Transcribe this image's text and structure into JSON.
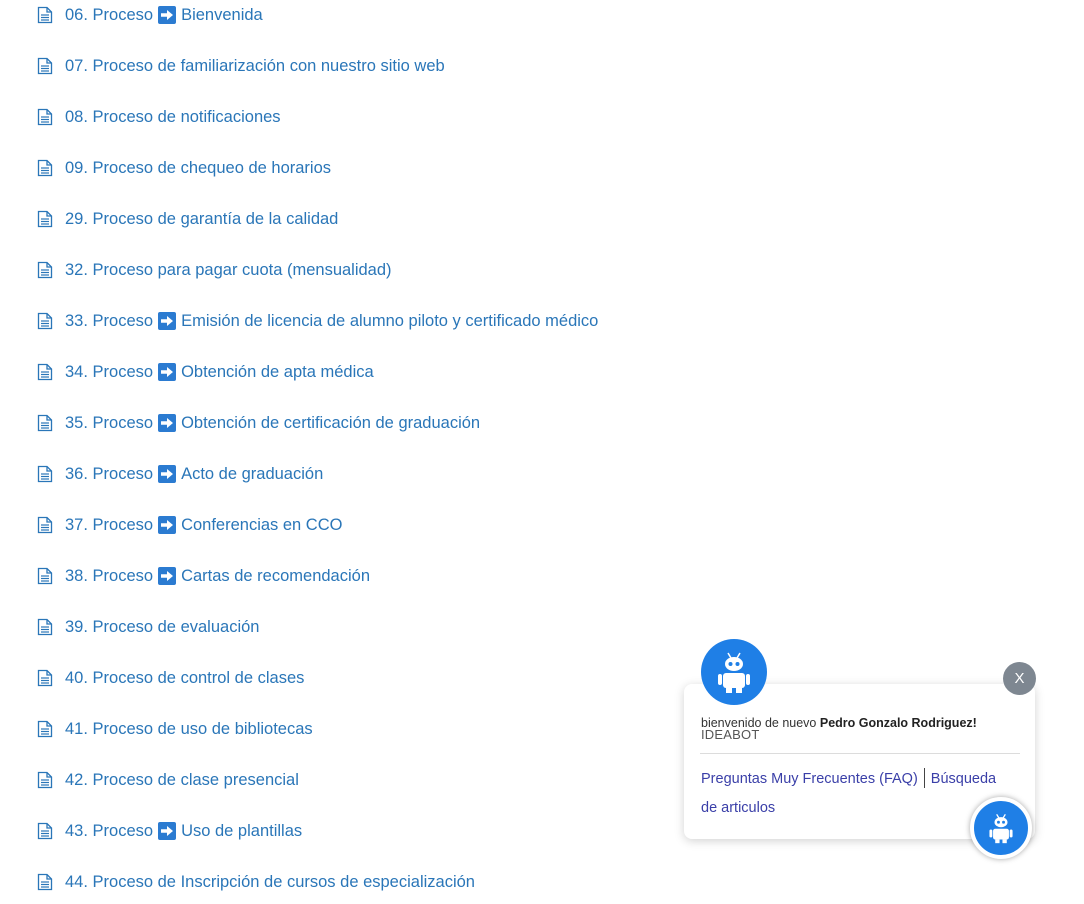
{
  "icons": {
    "document": "document-icon",
    "arrow": "right-arrow-box-icon",
    "bot": "robot-icon"
  },
  "colors": {
    "link": "#2a76b8",
    "arrow_box": "#2b7bd1",
    "bot_blue": "#1f7fe6",
    "close_gray": "#7e8791",
    "chat_link": "#3a3fa8"
  },
  "articles": [
    {
      "prefix": "06. Proceso",
      "arrow": true,
      "title": "Bienvenida"
    },
    {
      "prefix": "07. Proceso de familiarización con nuestro sitio web",
      "arrow": false,
      "title": ""
    },
    {
      "prefix": "08. Proceso de notificaciones",
      "arrow": false,
      "title": ""
    },
    {
      "prefix": "09. Proceso de chequeo de horarios",
      "arrow": false,
      "title": ""
    },
    {
      "prefix": "29. Proceso de garantía de la calidad",
      "arrow": false,
      "title": ""
    },
    {
      "prefix": "32. Proceso para pagar cuota (mensualidad)",
      "arrow": false,
      "title": ""
    },
    {
      "prefix": "33. Proceso",
      "arrow": true,
      "title": "Emisión de licencia de alumno piloto y certificado médico"
    },
    {
      "prefix": "34. Proceso",
      "arrow": true,
      "title": "Obtención de apta médica"
    },
    {
      "prefix": "35. Proceso",
      "arrow": true,
      "title": "Obtención de certificación de graduación"
    },
    {
      "prefix": "36. Proceso",
      "arrow": true,
      "title": "Acto de graduación"
    },
    {
      "prefix": "37. Proceso",
      "arrow": true,
      "title": "Conferencias en CCO"
    },
    {
      "prefix": "38. Proceso",
      "arrow": true,
      "title": "Cartas de recomendación"
    },
    {
      "prefix": "39. Proceso de evaluación",
      "arrow": false,
      "title": ""
    },
    {
      "prefix": "40. Proceso de control de clases",
      "arrow": false,
      "title": ""
    },
    {
      "prefix": "41. Proceso de uso de bibliotecas",
      "arrow": false,
      "title": ""
    },
    {
      "prefix": "42. Proceso de clase presencial",
      "arrow": false,
      "title": ""
    },
    {
      "prefix": "43. Proceso",
      "arrow": true,
      "title": "Uso de plantillas"
    },
    {
      "prefix": "44. Proceso de Inscripción de cursos de especialización",
      "arrow": false,
      "title": ""
    }
  ],
  "chat": {
    "close_label": "X",
    "greeting": "bienvenido de nuevo",
    "user_name": "Pedro Gonzalo Rodriguez!",
    "bot_name": "IDEABOT",
    "faq_link": "Preguntas Muy Frecuentes (FAQ)",
    "search_link": "Búsqueda de articulos"
  }
}
